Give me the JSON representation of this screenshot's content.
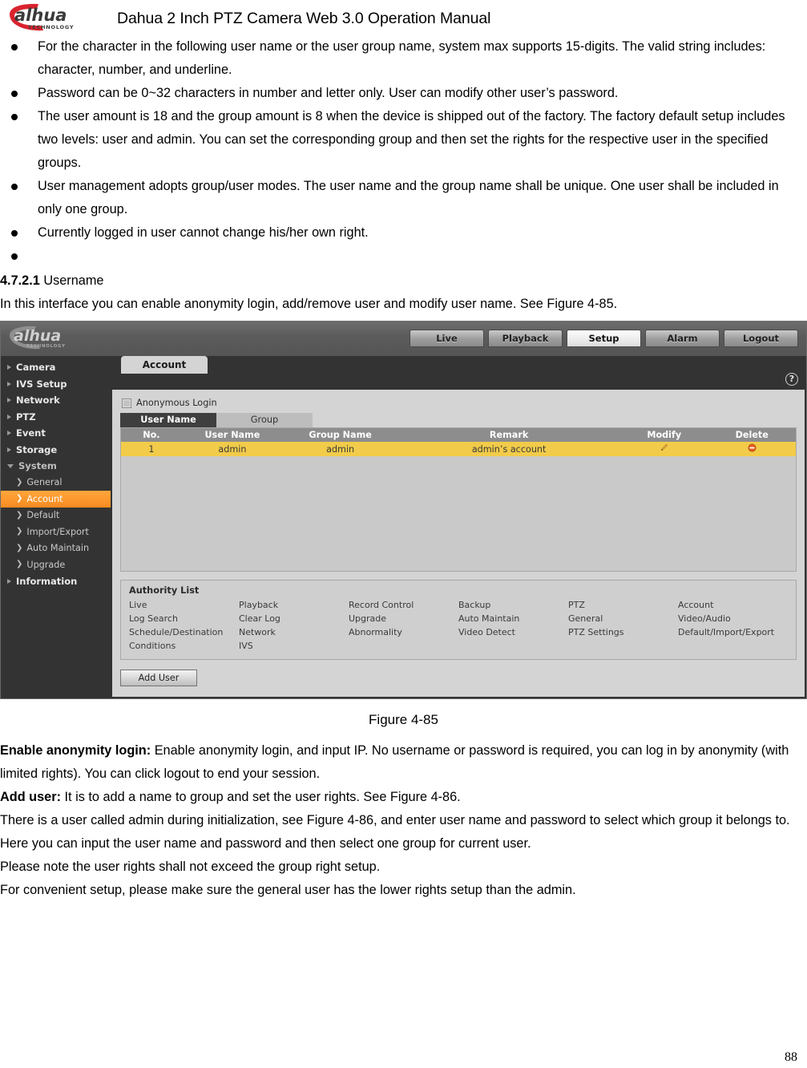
{
  "document": {
    "header_title": "Dahua 2 Inch PTZ Camera Web 3.0 Operation Manual",
    "logo_text": "alhua",
    "logo_sub": "TECHNOLOGY",
    "page_number": "88"
  },
  "bullets": [
    "For the character in the following user name or the user group name, system max supports 15-digits. The valid string includes: character, number, and underline.",
    "Password can be 0~32 characters in number and letter only. User can modify other user’s password.",
    "The user amount is 18 and the group amount is 8 when the device is shipped out of the factory. The factory default setup includes two levels: user and admin. You can set the corresponding group and then set the rights for the respective user in the specified groups.",
    "User management adopts group/user modes. The user name and the group name shall be unique. One user shall be included in only one group.",
    "Currently logged in user cannot change his/her own right.",
    ""
  ],
  "section": {
    "number": "4.7.2.1",
    "title": "Username",
    "intro": "In this interface you can enable anonymity login, add/remove user and modify user name. See Figure 4-85."
  },
  "figure": {
    "caption": "Figure 4-85"
  },
  "webui": {
    "logo_text": "alhua",
    "logo_sub": "TECHNOLOGY",
    "nav": [
      {
        "label": "Live",
        "active": false
      },
      {
        "label": "Playback",
        "active": false
      },
      {
        "label": "Setup",
        "active": true
      },
      {
        "label": "Alarm",
        "active": false
      },
      {
        "label": "Logout",
        "active": false
      }
    ],
    "help_icon": "?",
    "sidebar": [
      {
        "label": "Camera",
        "type": "top",
        "open": false
      },
      {
        "label": "IVS Setup",
        "type": "top",
        "open": false
      },
      {
        "label": "Network",
        "type": "top",
        "open": false
      },
      {
        "label": "PTZ",
        "type": "top",
        "open": false
      },
      {
        "label": "Event",
        "type": "top",
        "open": false
      },
      {
        "label": "Storage",
        "type": "top",
        "open": false
      },
      {
        "label": "System",
        "type": "top",
        "open": true
      },
      {
        "label": "General",
        "type": "sub",
        "selected": false
      },
      {
        "label": "Account",
        "type": "sub",
        "selected": true
      },
      {
        "label": "Default",
        "type": "sub",
        "selected": false
      },
      {
        "label": "Import/Export",
        "type": "sub",
        "selected": false
      },
      {
        "label": "Auto Maintain",
        "type": "sub",
        "selected": false
      },
      {
        "label": "Upgrade",
        "type": "sub",
        "selected": false
      },
      {
        "label": "Information",
        "type": "top",
        "open": false
      }
    ],
    "tab_label": "Account",
    "anonymous_login_label": "Anonymous Login",
    "anonymous_login_checked": false,
    "subtabs": [
      {
        "label": "User Name",
        "active": true
      },
      {
        "label": "Group",
        "active": false
      }
    ],
    "table": {
      "headers": [
        "No.",
        "User Name",
        "Group Name",
        "Remark",
        "Modify",
        "Delete"
      ],
      "rows": [
        {
          "no": "1",
          "user_name": "admin",
          "group_name": "admin",
          "remark": "admin’s account",
          "modify_icon": "pencil-icon",
          "delete_icon": "delete-circle-icon",
          "selected": true
        }
      ]
    },
    "authority": {
      "title": "Authority List",
      "items": [
        "Live",
        "Playback",
        "Record Control",
        "Backup",
        "PTZ",
        "Account",
        "Log Search",
        "Clear Log",
        "Upgrade",
        "Auto Maintain",
        "General",
        "Video/Audio",
        "Schedule/Destination",
        "Network",
        "Abnormality",
        "Video Detect",
        "PTZ Settings",
        "Default/Import/Export",
        "Conditions",
        "IVS"
      ]
    },
    "add_user_label": "Add User",
    "colors": {
      "accent_orange": "#f78b20",
      "row_highlight": "#f2cb4a",
      "sidebar_bg": "#333333",
      "panel_bg": "#d4d4d4",
      "header_gray": "#8d8d8d",
      "logo_red": "#d9232e"
    }
  },
  "tail": {
    "p1_bold": "Enable anonymity login:",
    "p1_rest": " Enable anonymity login, and input IP. No username or password is required, you can log in by anonymity (with limited rights). You can click logout to end your session.",
    "p2_bold": "Add user:",
    "p2_rest": " It is to add a name to group and set the user rights. See Figure 4-86.",
    "p3": "There is a user called admin during initialization, see Figure 4-86, and enter user name and password to select which group it belongs to.",
    "p4": "Here you can input the user name and password and then select one group for current user.",
    "p5": "Please note the user rights shall not exceed the group right setup.",
    "p6": "For convenient setup, please make sure the general user has the lower rights setup than the admin."
  }
}
